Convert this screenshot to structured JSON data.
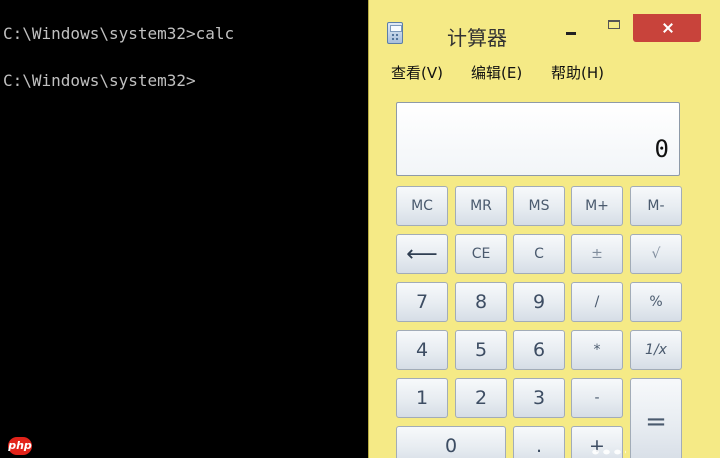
{
  "console": {
    "lines": [
      "C:\\Windows\\system32>calc",
      "C:\\Windows\\system32>"
    ]
  },
  "calculator": {
    "title": "计算器",
    "icon": "calculator-icon",
    "window_buttons": [
      "minimize",
      "maximize",
      "close"
    ],
    "menu": [
      "查看(V)",
      "编辑(E)",
      "帮助(H)"
    ],
    "display": "0",
    "keys": {
      "mc": "MC",
      "mr": "MR",
      "ms": "MS",
      "mplus": "M+",
      "mminus": "M-",
      "backspace": "⟵",
      "ce": "CE",
      "c": "C",
      "plusminus": "±",
      "sqrt": "√",
      "k7": "7",
      "k8": "8",
      "k9": "9",
      "divide": "/",
      "percent": "%",
      "k4": "4",
      "k5": "5",
      "k6": "6",
      "multiply": "*",
      "reciprocal": "1/x",
      "k1": "1",
      "k2": "2",
      "k3": "3",
      "minus": "-",
      "equals": "=",
      "k0": "0",
      "decimal": ".",
      "plus": "+"
    }
  },
  "watermark": "php",
  "colors": {
    "calc_background": "#f5ea86",
    "close_button": "#c8433b",
    "console_background": "#000000",
    "console_text": "#c0c0c0"
  }
}
